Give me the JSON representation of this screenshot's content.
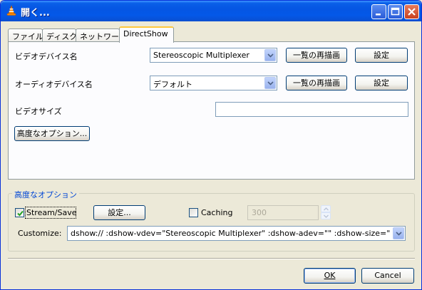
{
  "window": {
    "title": "開く...",
    "icon": "vlc-cone-icon"
  },
  "tabs": [
    {
      "label": "ファイル",
      "active": false
    },
    {
      "label": "ディスク",
      "active": false
    },
    {
      "label": "ネットワーク",
      "active": false
    },
    {
      "label": "DirectShow",
      "active": true
    }
  ],
  "directshow": {
    "video_device_label": "ビデオデバイス名",
    "video_device_value": "Stereoscopic Multiplexer",
    "audio_device_label": "オーディオデバイス名",
    "audio_device_value": "デフォルト",
    "refresh_label": "一覧の再描画",
    "settings_label": "設定",
    "video_size_label": "ビデオサイズ",
    "video_size_value": "",
    "advanced_options_label": "高度なオプション..."
  },
  "advanced_group": {
    "title": "高度なオプション",
    "stream_save_label": "Stream/Save",
    "stream_save_checked": true,
    "settings_button_label": "設定...",
    "caching_label": "Caching",
    "caching_checked": false,
    "caching_value": "300",
    "customize_label": "Customize:",
    "customize_value": "dshow:// :dshow-vdev=\"Stereoscopic Multiplexer\" :dshow-adev=\"\" :dshow-size=\""
  },
  "footer": {
    "ok_label": "OK",
    "cancel_label": "Cancel"
  },
  "colors": {
    "titlebar": "#0556E3",
    "window_bg": "#ECE9D8",
    "group_title": "#0046D5",
    "active_tab_accent": "#FFC83C"
  }
}
